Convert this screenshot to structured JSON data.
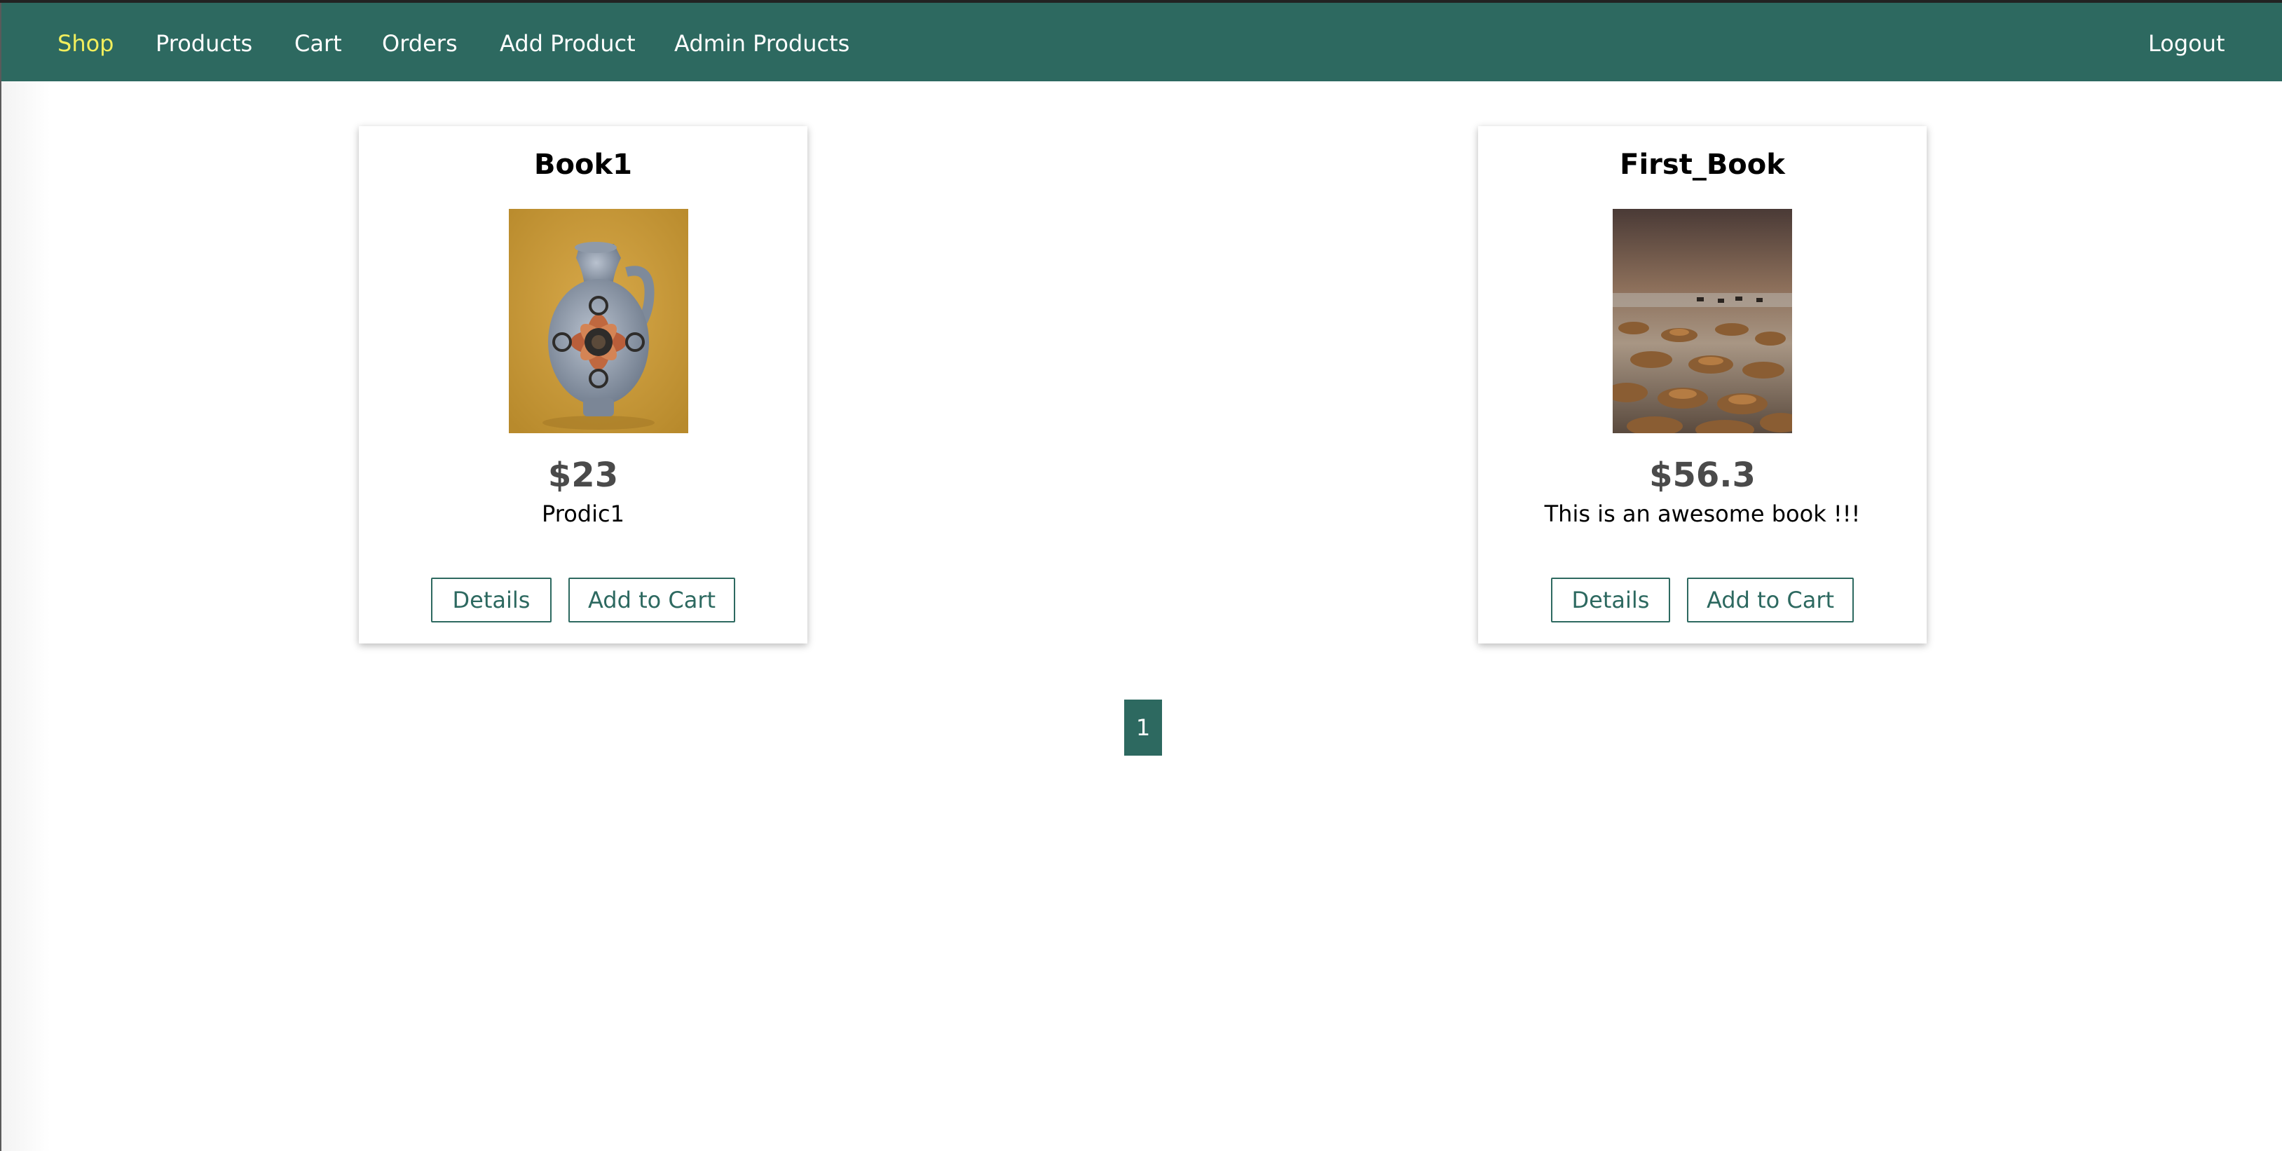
{
  "nav": {
    "items": [
      {
        "label": "Shop",
        "active": true
      },
      {
        "label": "Products"
      },
      {
        "label": "Cart"
      },
      {
        "label": "Orders"
      },
      {
        "label": "Add Product"
      },
      {
        "label": "Admin Products"
      }
    ],
    "logout_label": "Logout",
    "active_color": "#f2ee5c",
    "bar_color": "#2d6960"
  },
  "products": [
    {
      "title": "Book1",
      "price": "$23",
      "description": "Prodic1",
      "image": "vase-photo",
      "details_label": "Details",
      "add_to_cart_label": "Add to Cart"
    },
    {
      "title": "First_Book",
      "price": "$56.3",
      "description": "This is an awesome book !!!",
      "image": "landscape-photo",
      "details_label": "Details",
      "add_to_cart_label": "Add to Cart"
    }
  ],
  "pagination": {
    "current_page": "1"
  }
}
